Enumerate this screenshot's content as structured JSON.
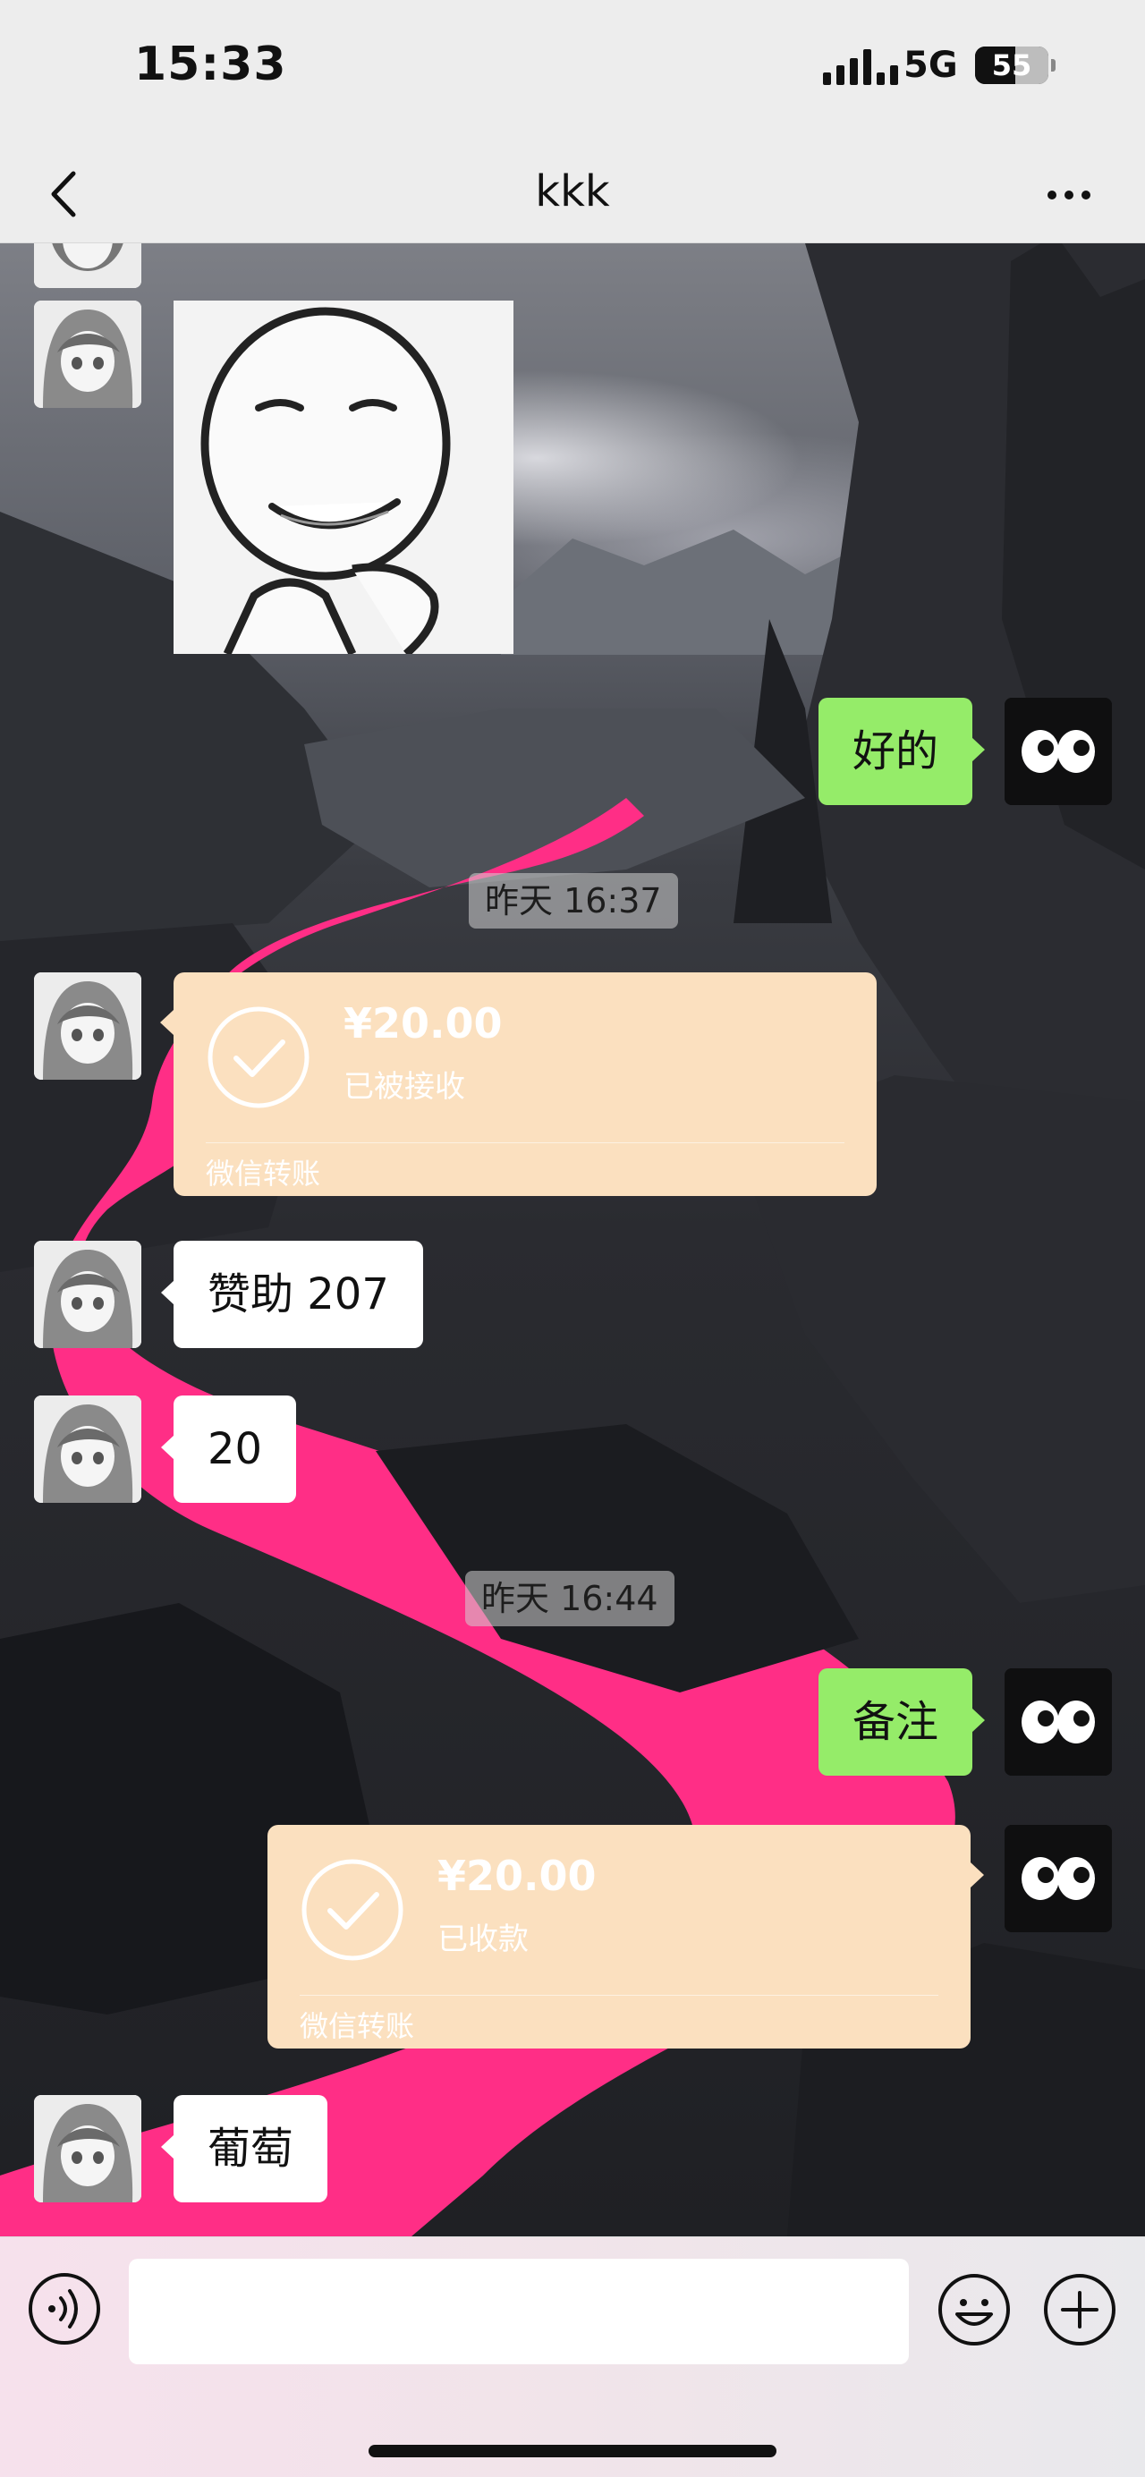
{
  "status_bar": {
    "time": "15:33",
    "network": "5G",
    "battery_percent": "55",
    "battery_level": 0.55
  },
  "nav": {
    "title": "kkk",
    "back_icon": "chevron-left-icon",
    "more_icon": "more-dots-icon"
  },
  "messages": {
    "sticker_icon": "meme-face-sticker",
    "reply_ok": "好的",
    "time_1": "昨天 16:37",
    "transfer_in": {
      "amount": "¥20.00",
      "status": "已被接收",
      "label": "微信转账"
    },
    "sponsor": "赞助 207",
    "number": "20",
    "time_2": "昨天 16:44",
    "note": "备注",
    "transfer_out": {
      "amount": "¥20.00",
      "status": "已收款",
      "label": "微信转账"
    },
    "grapes": "葡萄"
  },
  "input_bar": {
    "voice_icon": "voice-icon",
    "emoji_icon": "emoji-icon",
    "plus_icon": "plus-circle-icon",
    "text": ""
  },
  "colors": {
    "outgoing_bubble": "#95ec69",
    "incoming_bubble": "#ffffff",
    "transfer_card": "#fbe0bf",
    "river": "#ff2e86"
  }
}
